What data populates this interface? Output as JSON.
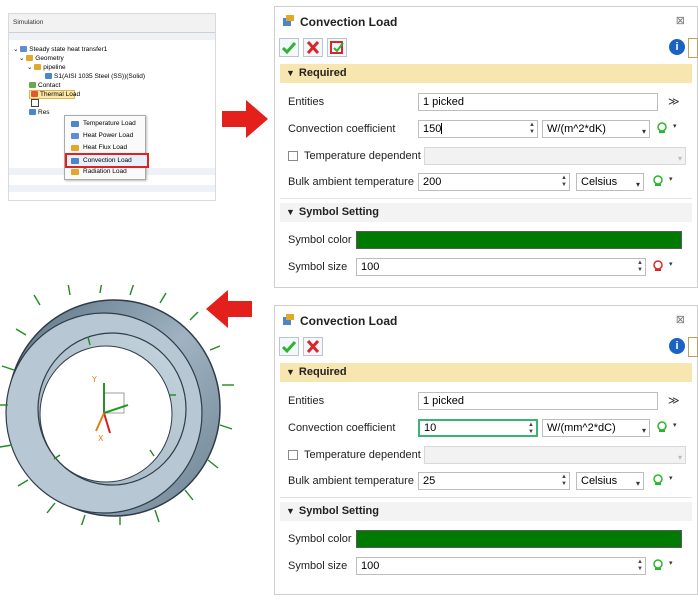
{
  "simulation": {
    "header": "Simulation",
    "tree": [
      {
        "label": "Steady state heat transfer1",
        "indent": 0
      },
      {
        "label": "Geometry",
        "indent": 1
      },
      {
        "label": "pipeline",
        "indent": 2
      },
      {
        "label": "S1(AISI 1035 Steel (SS))(Solid)",
        "indent": 3
      },
      {
        "label": "Contact",
        "indent": 1
      },
      {
        "label": "Thermal Load",
        "indent": 1
      },
      {
        "label": "Res",
        "indent": 1
      }
    ],
    "context_menu": [
      "Temperature Load",
      "Heat Power Load",
      "Heat Flux Load",
      "Convection Load",
      "Radiation Load"
    ]
  },
  "dialog_top": {
    "title": "Convection Load",
    "required_label": "Required",
    "entities_label": "Entities",
    "entities_value": "1 picked",
    "coef_label": "Convection coefficient",
    "coef_value": "150",
    "coef_unit": "W/(m^2*dK)",
    "temp_dep_label": "Temperature dependent",
    "bulk_label": "Bulk ambient temperature",
    "bulk_value": "200",
    "bulk_unit": "Celsius",
    "symbol_label": "Symbol Setting",
    "symbol_color_label": "Symbol color",
    "symbol_color": "#007a00",
    "symbol_size_label": "Symbol size",
    "symbol_size_value": "100"
  },
  "dialog_bottom": {
    "title": "Convection Load",
    "required_label": "Required",
    "entities_label": "Entities",
    "entities_value": "1 picked",
    "coef_label": "Convection coefficient",
    "coef_value": "10",
    "coef_unit": "W/(mm^2*dC)",
    "temp_dep_label": "Temperature dependent",
    "bulk_label": "Bulk ambient temperature",
    "bulk_value": "25",
    "bulk_unit": "Celsius",
    "symbol_label": "Symbol Setting",
    "symbol_color_label": "Symbol color",
    "symbol_color": "#007a00",
    "symbol_size_label": "Symbol size",
    "symbol_size_value": "100"
  },
  "colors": {
    "arrow": "#e3201b",
    "section_required": "#f8e6b0",
    "ok_green": "#2db32d",
    "cancel_red": "#d9262b",
    "info_blue": "#1a62c4"
  },
  "icons": [
    "ok-icon",
    "cancel-icon",
    "apply-icon",
    "info-icon",
    "help-icon",
    "close-icon",
    "expand-icon",
    "pick-icon"
  ]
}
